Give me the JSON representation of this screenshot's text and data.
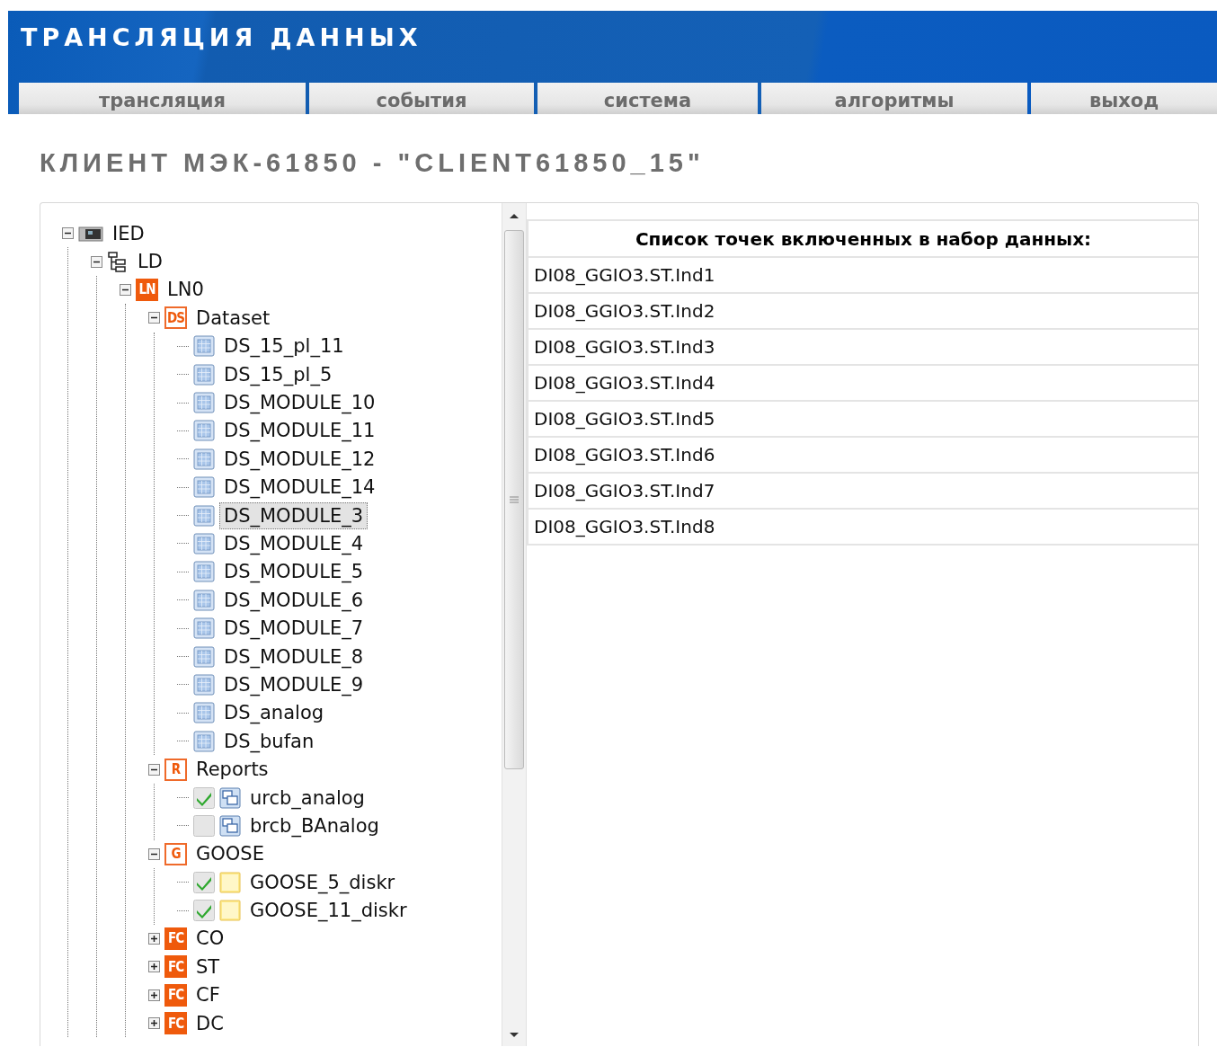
{
  "header": {
    "title": "ТРАНСЛЯЦИЯ ДАННЫХ"
  },
  "tabs": [
    {
      "label": "трансляция"
    },
    {
      "label": "события"
    },
    {
      "label": "система"
    },
    {
      "label": "алгоритмы"
    },
    {
      "label": "выход"
    }
  ],
  "page_title": "КЛИЕНТ МЭК-61850 - \"CLIENT61850_15\"",
  "tree": {
    "items": [
      {
        "kind": "ied",
        "label": "IED",
        "expanded": true,
        "children": [
          {
            "kind": "ld",
            "label": "LD",
            "expanded": true,
            "children": [
              {
                "kind": "ln",
                "badge": "LN",
                "label": "LN0",
                "expanded": true,
                "children": [
                  {
                    "kind": "folder",
                    "badge": "DS",
                    "label": "Dataset",
                    "expanded": true,
                    "children": [
                      {
                        "kind": "dataset",
                        "label": "DS_15_pl_11",
                        "selected": false
                      },
                      {
                        "kind": "dataset",
                        "label": "DS_15_pl_5",
                        "selected": false
                      },
                      {
                        "kind": "dataset",
                        "label": "DS_MODULE_10",
                        "selected": false
                      },
                      {
                        "kind": "dataset",
                        "label": "DS_MODULE_11",
                        "selected": false
                      },
                      {
                        "kind": "dataset",
                        "label": "DS_MODULE_12",
                        "selected": false
                      },
                      {
                        "kind": "dataset",
                        "label": "DS_MODULE_14",
                        "selected": false
                      },
                      {
                        "kind": "dataset",
                        "label": "DS_MODULE_3",
                        "selected": true
                      },
                      {
                        "kind": "dataset",
                        "label": "DS_MODULE_4",
                        "selected": false
                      },
                      {
                        "kind": "dataset",
                        "label": "DS_MODULE_5",
                        "selected": false
                      },
                      {
                        "kind": "dataset",
                        "label": "DS_MODULE_6",
                        "selected": false
                      },
                      {
                        "kind": "dataset",
                        "label": "DS_MODULE_7",
                        "selected": false
                      },
                      {
                        "kind": "dataset",
                        "label": "DS_MODULE_8",
                        "selected": false
                      },
                      {
                        "kind": "dataset",
                        "label": "DS_MODULE_9",
                        "selected": false
                      },
                      {
                        "kind": "dataset",
                        "label": "DS_analog",
                        "selected": false
                      },
                      {
                        "kind": "dataset",
                        "label": "DS_bufan",
                        "selected": false
                      }
                    ]
                  },
                  {
                    "kind": "folder",
                    "badge": "R",
                    "label": "Reports",
                    "expanded": true,
                    "children": [
                      {
                        "kind": "report",
                        "label": "urcb_analog",
                        "checked": true
                      },
                      {
                        "kind": "report",
                        "label": "brcb_BAnalog",
                        "checked": false
                      }
                    ]
                  },
                  {
                    "kind": "folder",
                    "badge": "G",
                    "label": "GOOSE",
                    "expanded": true,
                    "children": [
                      {
                        "kind": "goose",
                        "label": "GOOSE_5_diskr",
                        "checked": true
                      },
                      {
                        "kind": "goose",
                        "label": "GOOSE_11_diskr",
                        "checked": true
                      }
                    ]
                  },
                  {
                    "kind": "fc",
                    "badge": "FC",
                    "label": "CO",
                    "expanded": false
                  },
                  {
                    "kind": "fc",
                    "badge": "FC",
                    "label": "ST",
                    "expanded": false
                  },
                  {
                    "kind": "fc",
                    "badge": "FC",
                    "label": "CF",
                    "expanded": false
                  },
                  {
                    "kind": "fc",
                    "badge": "FC",
                    "label": "DC",
                    "expanded": false
                  }
                ]
              }
            ]
          }
        ]
      }
    ]
  },
  "points": {
    "title": "Список точек включенных в набор данных:",
    "rows": [
      "DI08_GGIO3.ST.Ind1",
      "DI08_GGIO3.ST.Ind2",
      "DI08_GGIO3.ST.Ind3",
      "DI08_GGIO3.ST.Ind4",
      "DI08_GGIO3.ST.Ind5",
      "DI08_GGIO3.ST.Ind6",
      "DI08_GGIO3.ST.Ind7",
      "DI08_GGIO3.ST.Ind8"
    ]
  }
}
